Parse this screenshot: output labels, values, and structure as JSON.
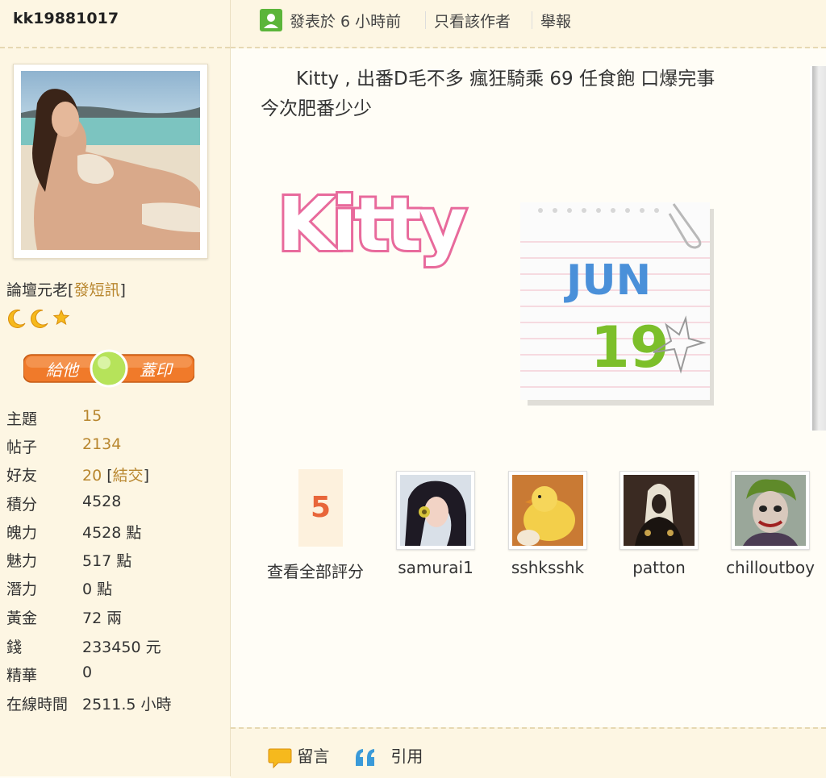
{
  "author": {
    "username": "kk19881017",
    "rank": "論壇元老",
    "pm_link": "發短訊",
    "stamp_left": "給他",
    "stamp_right": "蓋印"
  },
  "stats": [
    {
      "key": "主題",
      "value": "15"
    },
    {
      "key": "帖子",
      "value": "2134"
    },
    {
      "key": "好友",
      "value": "20",
      "extra": "結交"
    },
    {
      "key": "積分",
      "value": "4528"
    },
    {
      "key": "魄力",
      "value": "4528 點"
    },
    {
      "key": "魅力",
      "value": "517 點"
    },
    {
      "key": "潛力",
      "value": "0 點"
    },
    {
      "key": "黃金",
      "value": "72 兩"
    },
    {
      "key": "錢",
      "value": "233450 元"
    },
    {
      "key": "精華",
      "value": "0"
    },
    {
      "key": "在線時間",
      "value": "2511.5 小時"
    }
  ],
  "topbar": {
    "posted": "發表於 6 小時前",
    "only_author": "只看該作者",
    "report": "舉報"
  },
  "post": {
    "line1": "Kitty , 出番D毛不多 瘋狂騎乘 69 任食飽 口爆完事",
    "line2": "今次肥番少少",
    "logo_text": "Kitty",
    "calendar_month": "JUN",
    "calendar_day": "19"
  },
  "ratings": {
    "count": "5",
    "view_all": "查看全部評分",
    "raters": [
      "samurai1",
      "sshksshk",
      "patton",
      "chilloutboy"
    ]
  },
  "bottombar": {
    "comment": "留言",
    "quote": "引用"
  },
  "colors": {
    "accent_gold": "#b8862e",
    "sidebar_bg": "#fdf6e3",
    "rate_orange": "#e8663a",
    "stamp_orange": "#f07a2a",
    "logo_pink": "#e86a9c"
  }
}
